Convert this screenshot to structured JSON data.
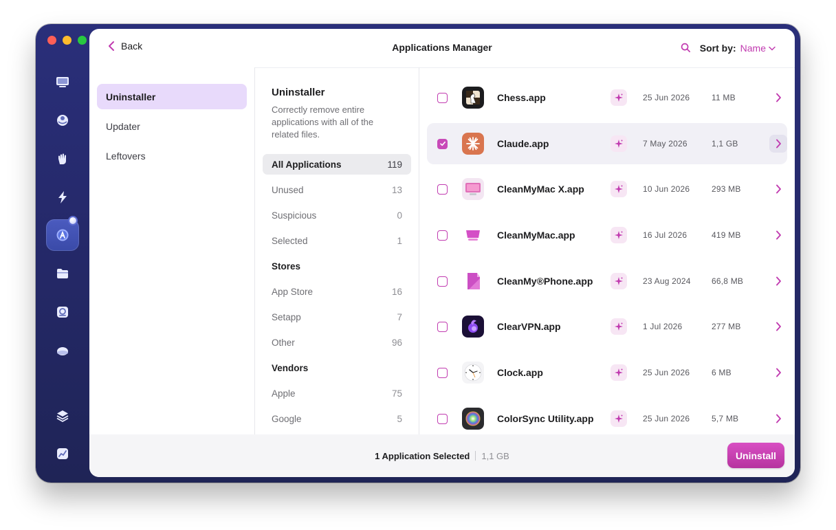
{
  "window": {
    "title": "Applications Manager",
    "back_label": "Back",
    "sort_label": "Sort by:",
    "sort_value": "Name",
    "accent": "#c13bb0"
  },
  "rail": {
    "items": [
      {
        "icon": "display-icon"
      },
      {
        "icon": "protection-icon"
      },
      {
        "icon": "privacy-hand-icon"
      },
      {
        "icon": "speed-bolt-icon"
      },
      {
        "icon": "applications-icon",
        "active": true
      },
      {
        "icon": "folder-icon"
      },
      {
        "icon": "space-lens-icon"
      },
      {
        "icon": "cloud-icon"
      },
      {
        "icon": "assistant-layers-icon"
      },
      {
        "icon": "menu-chart-icon"
      }
    ]
  },
  "modules": [
    {
      "label": "Uninstaller",
      "active": true
    },
    {
      "label": "Updater"
    },
    {
      "label": "Leftovers"
    }
  ],
  "filters": {
    "title": "Uninstaller",
    "description": "Correctly remove entire applications with all of the related files.",
    "rows": [
      {
        "label": "All Applications",
        "count": "119",
        "active": true
      },
      {
        "label": "Unused",
        "count": "13"
      },
      {
        "label": "Suspicious",
        "count": "0"
      },
      {
        "label": "Selected",
        "count": "1"
      },
      {
        "header": "Stores"
      },
      {
        "label": "App Store",
        "count": "16"
      },
      {
        "label": "Setapp",
        "count": "7"
      },
      {
        "label": "Other",
        "count": "96"
      },
      {
        "header": "Vendors"
      },
      {
        "label": "Apple",
        "count": "75"
      },
      {
        "label": "Google",
        "count": "5"
      }
    ]
  },
  "apps": [
    {
      "name": "Chess.app",
      "date": "25 Jun 2026",
      "size": "11 MB",
      "checked": false,
      "icon": "chess-app-icon"
    },
    {
      "name": "Claude.app",
      "date": "7 May 2026",
      "size": "1,1 GB",
      "checked": true,
      "selected": true,
      "icon": "claude-app-icon"
    },
    {
      "name": "CleanMyMac X.app",
      "date": "10 Jun 2026",
      "size": "293 MB",
      "checked": false,
      "icon": "cleanmymac-x-app-icon"
    },
    {
      "name": "CleanMyMac.app",
      "date": "16 Jul 2026",
      "size": "419 MB",
      "checked": false,
      "icon": "cleanmymac-app-icon"
    },
    {
      "name": "CleanMy®Phone.app",
      "date": "23 Aug 2024",
      "size": "66,8 MB",
      "checked": false,
      "icon": "cleanmyphone-app-icon"
    },
    {
      "name": "ClearVPN.app",
      "date": "1 Jul 2026",
      "size": "277 MB",
      "checked": false,
      "icon": "clearvpn-app-icon"
    },
    {
      "name": "Clock.app",
      "date": "25 Jun 2026",
      "size": "6 MB",
      "checked": false,
      "icon": "clock-app-icon"
    },
    {
      "name": "ColorSync Utility.app",
      "date": "25 Jun 2026",
      "size": "5,7 MB",
      "checked": false,
      "icon": "colorsync-app-icon"
    }
  ],
  "footer": {
    "selected_text": "1 Application Selected",
    "selected_size": "1,1 GB",
    "uninstall_label": "Uninstall"
  }
}
